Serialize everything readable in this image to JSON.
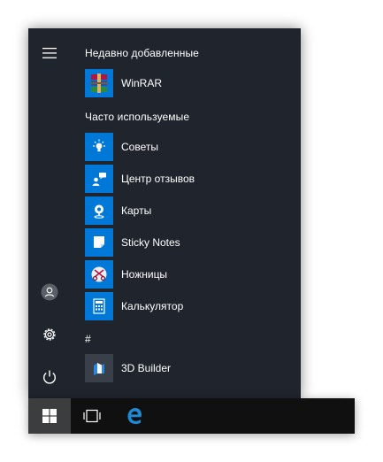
{
  "recent": {
    "header": "Недавно добавленные",
    "items": [
      {
        "label": "WinRAR",
        "icon": "winrar-icon"
      }
    ]
  },
  "frequent": {
    "header": "Часто используемые",
    "items": [
      {
        "label": "Советы",
        "icon": "lightbulb-icon"
      },
      {
        "label": "Центр отзывов",
        "icon": "feedback-icon"
      },
      {
        "label": "Карты",
        "icon": "map-pin-icon"
      },
      {
        "label": "Sticky Notes",
        "icon": "sticky-note-icon"
      },
      {
        "label": "Ножницы",
        "icon": "scissors-icon"
      },
      {
        "label": "Калькулятор",
        "icon": "calculator-icon"
      }
    ]
  },
  "hash_section": {
    "header": "#",
    "items": [
      {
        "label": "3D Builder",
        "icon": "3d-builder-icon"
      }
    ]
  },
  "colors": {
    "menu_background": "#1f242d",
    "tile_accent": "#0078d7",
    "taskbar_background": "#101010",
    "start_button_active": "#3c3d3f",
    "edge_blue": "#1e8ad6"
  }
}
